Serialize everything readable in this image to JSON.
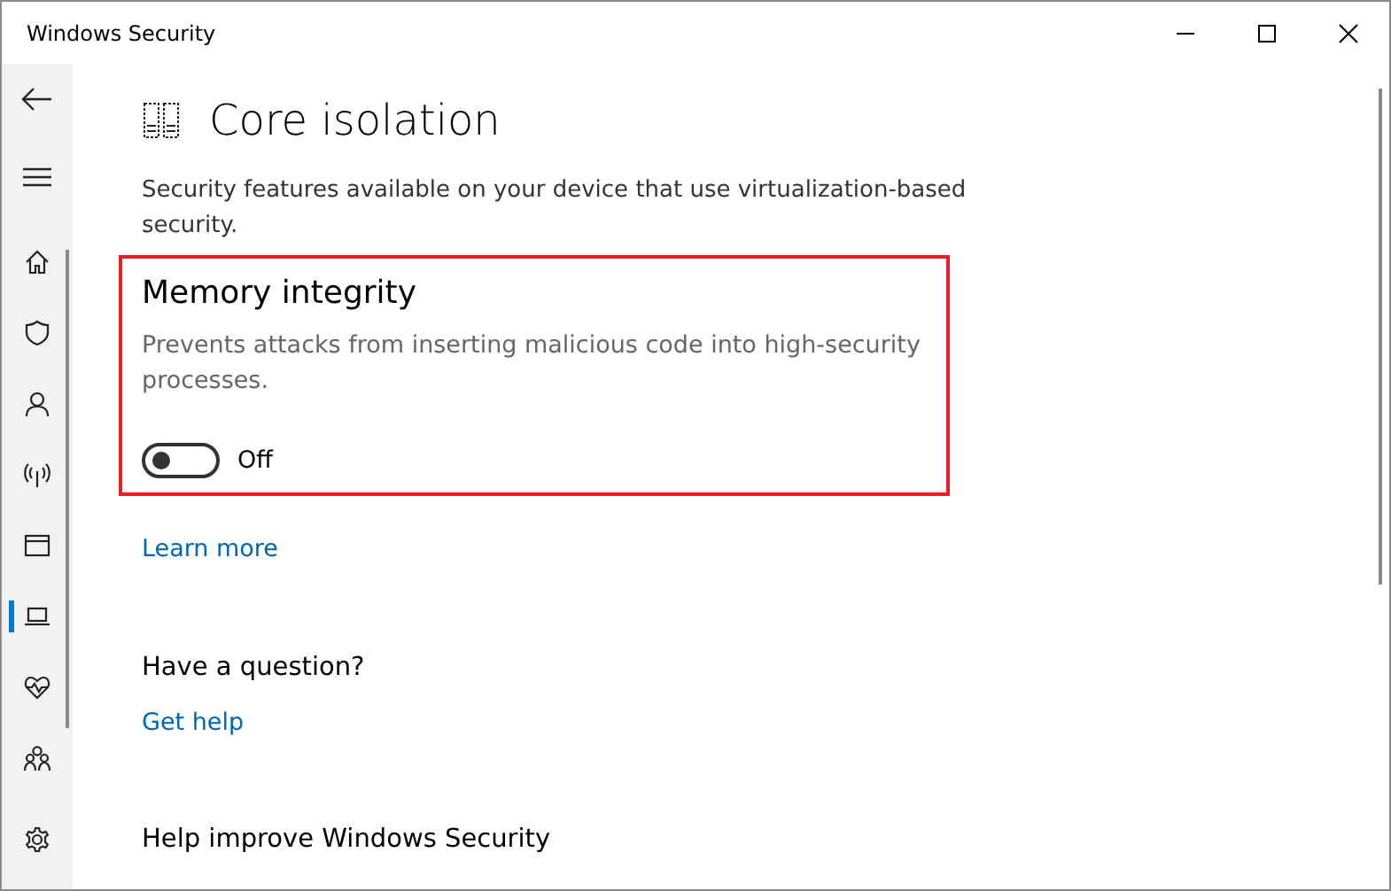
{
  "window": {
    "title": "Windows Security"
  },
  "sidebar": {
    "items": [
      {
        "selected": false
      },
      {
        "selected": false
      },
      {
        "selected": false
      },
      {
        "selected": false
      },
      {
        "selected": false
      },
      {
        "selected": true
      },
      {
        "selected": false
      },
      {
        "selected": false
      },
      {
        "selected": false
      }
    ]
  },
  "page": {
    "title": "Core isolation",
    "description": "Security features available on your device that use virtualization-based security."
  },
  "memory_integrity": {
    "title": "Memory integrity",
    "description": "Prevents attacks from inserting malicious code into high-security processes.",
    "on": false,
    "status": "Off"
  },
  "learn_more": "Learn more",
  "question": {
    "heading": "Have a question?",
    "link": "Get help"
  },
  "improve": {
    "heading": "Help improve Windows Security"
  }
}
